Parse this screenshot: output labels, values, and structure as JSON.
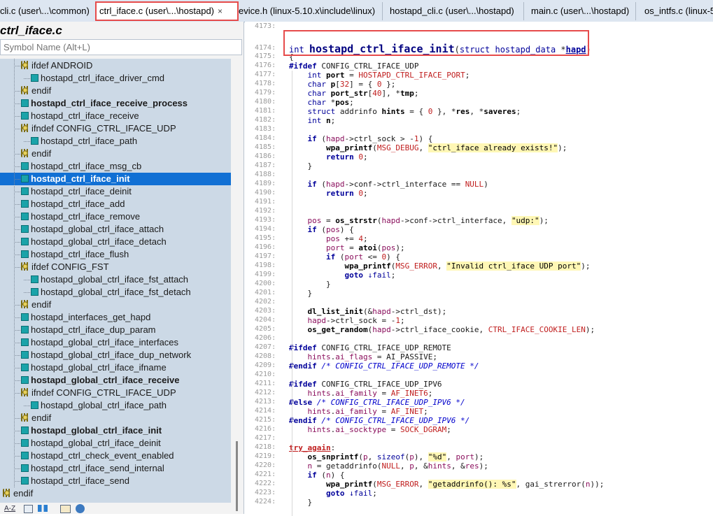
{
  "tabs": [
    {
      "label": "cli.c (user\\...\\common)"
    },
    {
      "label": "ctrl_iface.c (user\\...\\hostapd)",
      "close": "×"
    },
    {
      "label": "evice.h (linux-5.10.x\\include\\linux)"
    },
    {
      "label": "hostapd_cli.c (user\\...\\hostapd)"
    },
    {
      "label": "main.c (user\\...\\hostapd)"
    },
    {
      "label": "os_intfs.c (linux-5"
    }
  ],
  "symbol_panel": {
    "title": "ctrl_iface.c",
    "search_placeholder": "Symbol Name (Alt+L)",
    "items": [
      {
        "label": "ifdef ANDROID",
        "type": "pp",
        "indent": 1
      },
      {
        "label": "hostapd_ctrl_iface_driver_cmd",
        "type": "fn",
        "indent": 2
      },
      {
        "label": "endif",
        "type": "pp",
        "indent": 1
      },
      {
        "label": "hostapd_ctrl_iface_receive_process",
        "type": "fn",
        "indent": 1,
        "bold": true
      },
      {
        "label": "hostapd_ctrl_iface_receive",
        "type": "fn",
        "indent": 1
      },
      {
        "label": "ifndef CONFIG_CTRL_IFACE_UDP",
        "type": "pp",
        "indent": 1
      },
      {
        "label": "hostapd_ctrl_iface_path",
        "type": "fn",
        "indent": 2
      },
      {
        "label": "endif",
        "type": "pp",
        "indent": 1
      },
      {
        "label": "hostapd_ctrl_iface_msg_cb",
        "type": "fn",
        "indent": 1
      },
      {
        "label": "hostapd_ctrl_iface_init",
        "type": "fn",
        "indent": 1,
        "bold": true,
        "selected": true
      },
      {
        "label": "hostapd_ctrl_iface_deinit",
        "type": "fn",
        "indent": 1
      },
      {
        "label": "hostapd_ctrl_iface_add",
        "type": "fn",
        "indent": 1
      },
      {
        "label": "hostapd_ctrl_iface_remove",
        "type": "fn",
        "indent": 1
      },
      {
        "label": "hostapd_global_ctrl_iface_attach",
        "type": "fn",
        "indent": 1
      },
      {
        "label": "hostapd_global_ctrl_iface_detach",
        "type": "fn",
        "indent": 1
      },
      {
        "label": "hostapd_ctrl_iface_flush",
        "type": "fn",
        "indent": 1
      },
      {
        "label": "ifdef CONFIG_FST",
        "type": "pp",
        "indent": 1
      },
      {
        "label": "hostapd_global_ctrl_iface_fst_attach",
        "type": "fn",
        "indent": 2
      },
      {
        "label": "hostapd_global_ctrl_iface_fst_detach",
        "type": "fn",
        "indent": 2
      },
      {
        "label": "endif",
        "type": "pp",
        "indent": 1
      },
      {
        "label": "hostapd_interfaces_get_hapd",
        "type": "fn",
        "indent": 1
      },
      {
        "label": "hostapd_ctrl_iface_dup_param",
        "type": "fn",
        "indent": 1
      },
      {
        "label": "hostapd_global_ctrl_iface_interfaces",
        "type": "fn",
        "indent": 1
      },
      {
        "label": "hostapd_global_ctrl_iface_dup_network",
        "type": "fn",
        "indent": 1
      },
      {
        "label": "hostapd_global_ctrl_iface_ifname",
        "type": "fn",
        "indent": 1
      },
      {
        "label": "hostapd_global_ctrl_iface_receive",
        "type": "fn",
        "indent": 1,
        "bold": true
      },
      {
        "label": "ifndef CONFIG_CTRL_IFACE_UDP",
        "type": "pp",
        "indent": 1
      },
      {
        "label": "hostapd_global_ctrl_iface_path",
        "type": "fn",
        "indent": 2
      },
      {
        "label": "endif",
        "type": "pp",
        "indent": 1
      },
      {
        "label": "hostapd_global_ctrl_iface_init",
        "type": "fn",
        "indent": 1,
        "bold": true
      },
      {
        "label": "hostapd_global_ctrl_iface_deinit",
        "type": "fn",
        "indent": 1
      },
      {
        "label": "hostapd_ctrl_check_event_enabled",
        "type": "fn",
        "indent": 1
      },
      {
        "label": "hostapd_ctrl_iface_send_internal",
        "type": "fn",
        "indent": 1
      },
      {
        "label": "hostapd_ctrl_iface_send",
        "type": "fn",
        "indent": 1
      },
      {
        "label": "endif",
        "type": "pp",
        "indent": 0
      }
    ],
    "bottom_tool_label": "A-Z"
  },
  "editor": {
    "lines": [
      {
        "n": "4173:",
        "html": ""
      },
      {
        "n": "4174:",
        "html": "<span class=\"k\">int</span> <span style=\"font-size:15px;font-weight:bold;color:#000080\">hostapd_ctrl_iface_init</span>(<span class=\"k\">struct</span> <span class=\"k\">hostapd_data</span> *<span class=\"k\" style=\"text-decoration:underline;font-weight:bold\">hapd</span>)",
        "big": true
      },
      {
        "n": "4175:",
        "html": "{"
      },
      {
        "n": "4176:",
        "html": "<span class=\"kp\">#ifdef</span> CONFIG_CTRL_IFACE_UDP"
      },
      {
        "n": "4177:",
        "html": "    <span class=\"k\">int</span> <span class=\"fn\">port</span> = <span class=\"mac\">HOSTAPD_CTRL_IFACE_PORT</span>;"
      },
      {
        "n": "4178:",
        "html": "    <span class=\"k\">char</span> <span class=\"fn\">p</span>[<span class=\"num\">32</span>] = { <span class=\"num\">0</span> };"
      },
      {
        "n": "4179:",
        "html": "    <span class=\"k\">char</span> <span class=\"fn\">port_str</span>[<span class=\"num\">40</span>], *<span class=\"fn\">tmp</span>;"
      },
      {
        "n": "4180:",
        "html": "    <span class=\"k\">char</span> *<span class=\"fn\">pos</span>;"
      },
      {
        "n": "4181:",
        "html": "    <span class=\"k\">struct</span> addrinfo <span class=\"fn\">hints</span> = { <span class=\"num\">0</span> }, *<span class=\"fn\">res</span>, *<span class=\"fn\">saveres</span>;"
      },
      {
        "n": "4182:",
        "html": "    <span class=\"k\">int</span> <span class=\"fn\">n</span>;"
      },
      {
        "n": "4183:",
        "html": ""
      },
      {
        "n": "4184:",
        "html": "    <span class=\"kp\">if</span> (<span class=\"var\">hapd</span>-&gt;ctrl_sock &gt; -<span class=\"num\">1</span>) {"
      },
      {
        "n": "4185:",
        "html": "        <span class=\"fn\">wpa_printf</span>(<span class=\"mac\">MSG_DEBUG</span>, <span class=\"str\">\"ctrl_iface already exists!\"</span>);"
      },
      {
        "n": "4186:",
        "html": "        <span class=\"kp\">return</span> <span class=\"num\">0</span>;"
      },
      {
        "n": "4187:",
        "html": "    }"
      },
      {
        "n": "4188:",
        "html": ""
      },
      {
        "n": "4189:",
        "html": "    <span class=\"kp\">if</span> (<span class=\"var\">hapd</span>-&gt;conf-&gt;ctrl_interface == <span class=\"mac\">NULL</span>)"
      },
      {
        "n": "4190:",
        "html": "        <span class=\"kp\">return</span> <span class=\"num\">0</span>;"
      },
      {
        "n": "4191:",
        "html": ""
      },
      {
        "n": "4192:",
        "html": ""
      },
      {
        "n": "4193:",
        "html": "    <span class=\"var\">pos</span> = <span class=\"fn\">os_strstr</span>(<span class=\"var\">hapd</span>-&gt;conf-&gt;ctrl_interface, <span class=\"str\">\"udp:\"</span>);"
      },
      {
        "n": "4194:",
        "html": "    <span class=\"kp\">if</span> (<span class=\"var\">pos</span>) {"
      },
      {
        "n": "4195:",
        "html": "        <span class=\"var\">pos</span> += <span class=\"num\">4</span>;"
      },
      {
        "n": "4196:",
        "html": "        <span class=\"var\">port</span> = <span class=\"fn\">atoi</span>(<span class=\"var\">pos</span>);"
      },
      {
        "n": "4197:",
        "html": "        <span class=\"kp\">if</span> (<span class=\"var\">port</span> &lt;= <span class=\"num\">0</span>) {"
      },
      {
        "n": "4198:",
        "html": "            <span class=\"fn\">wpa_printf</span>(<span class=\"mac\">MSG_ERROR</span>, <span class=\"str\">\"Invalid ctrl_iface UDP port\"</span>);"
      },
      {
        "n": "4199:",
        "html": "            <span class=\"kp\">goto</span> <span class=\"k\">↓fail</span>;"
      },
      {
        "n": "4200:",
        "html": "        }"
      },
      {
        "n": "4201:",
        "html": "    }"
      },
      {
        "n": "4202:",
        "html": ""
      },
      {
        "n": "4203:",
        "html": "    <span class=\"fn\">dl_list_init</span>(&amp;<span class=\"var\">hapd</span>-&gt;ctrl_dst);"
      },
      {
        "n": "4204:",
        "html": "    <span class=\"var\">hapd</span>-&gt;ctrl_sock = -<span class=\"num\">1</span>;"
      },
      {
        "n": "4205:",
        "html": "    <span class=\"fn\">os_get_random</span>(<span class=\"var\">hapd</span>-&gt;ctrl_iface_cookie, <span class=\"mac\">CTRL_IFACE_COOKIE_LEN</span>);"
      },
      {
        "n": "4206:",
        "html": ""
      },
      {
        "n": "4207:",
        "html": "<span class=\"kp\">#ifdef</span> CONFIG_CTRL_IFACE_UDP_REMOTE"
      },
      {
        "n": "4208:",
        "html": "    <span class=\"var\">hints</span>.<span class=\"mem\">ai_flags</span> = AI_PASSIVE;"
      },
      {
        "n": "4209:",
        "html": "<span class=\"kp\">#endif</span> <span class=\"cm\">/* CONFIG_CTRL_IFACE_UDP_REMOTE */</span>"
      },
      {
        "n": "4210:",
        "html": ""
      },
      {
        "n": "4211:",
        "html": "<span class=\"kp\">#ifdef</span> CONFIG_CTRL_IFACE_UDP_IPV6"
      },
      {
        "n": "4212:",
        "html": "    <span class=\"var\">hints</span>.<span class=\"mem\">ai_family</span> = <span class=\"mac\">AF_INET6</span>;"
      },
      {
        "n": "4213:",
        "html": "<span class=\"kp\">#else</span> <span class=\"cm\">/* CONFIG_CTRL_IFACE_UDP_IPV6 */</span>"
      },
      {
        "n": "4214:",
        "html": "    <span class=\"var\">hints</span>.<span class=\"mem\">ai_family</span> = <span class=\"mac\">AF_INET</span>;"
      },
      {
        "n": "4215:",
        "html": "<span class=\"kp\">#endif</span> <span class=\"cm\">/* CONFIG_CTRL_IFACE_UDP_IPV6 */</span>"
      },
      {
        "n": "4216:",
        "html": "    <span class=\"var\">hints</span>.<span class=\"mem\">ai_socktype</span> = <span class=\"mac\">SOCK_DGRAM</span>;"
      },
      {
        "n": "4217:",
        "html": ""
      },
      {
        "n": "4218:",
        "html": "<span class=\"lbl2\">try_again</span>:"
      },
      {
        "n": "4219:",
        "html": "    <span class=\"fn\">os_snprintf</span>(<span class=\"var\">p</span>, <span class=\"k\">sizeof</span>(<span class=\"var\">p</span>), <span class=\"str\">\"%d\"</span>, <span class=\"var\">port</span>);"
      },
      {
        "n": "4220:",
        "html": "    <span class=\"var\">n</span> = getaddrinfo(<span class=\"mac\">NULL</span>, <span class=\"var\">p</span>, &amp;<span class=\"var\">hints</span>, &amp;<span class=\"var\">res</span>);"
      },
      {
        "n": "4221:",
        "html": "    <span class=\"kp\">if</span> (<span class=\"var\">n</span>) {"
      },
      {
        "n": "4222:",
        "html": "        <span class=\"fn\">wpa_printf</span>(<span class=\"mac\">MSG_ERROR</span>, <span class=\"str\">\"getaddrinfo(): %s\"</span>, gai_strerror(<span class=\"var\">n</span>));"
      },
      {
        "n": "4223:",
        "html": "        <span class=\"kp\">goto</span> <span class=\"k\">↓fail</span>;"
      },
      {
        "n": "4224:",
        "html": "    }"
      }
    ]
  }
}
